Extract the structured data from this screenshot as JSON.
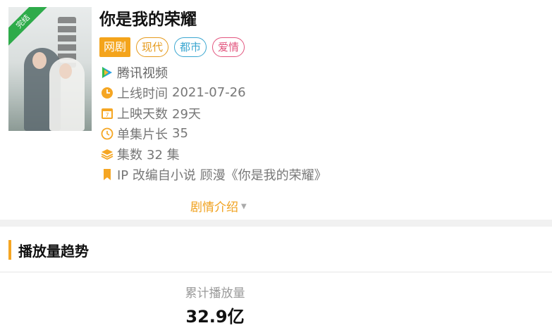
{
  "drama": {
    "poster_badge": "完结",
    "title": "你是我的荣耀",
    "type_tag": "网剧",
    "genre_tags": [
      "现代",
      "都市",
      "爱情"
    ],
    "platform": "腾讯视频",
    "release_label": "上线时间",
    "release_date": "2021-07-26",
    "days_label": "上映天数",
    "days_value": "29天",
    "episode_len_label": "单集片长",
    "episode_len_value": "35",
    "episodes_label": "集数",
    "episodes_value": "32 集",
    "ip_text": "IP 改编自小说 顾漫《你是我的荣耀》",
    "intro_link": "剧情介绍"
  },
  "trend": {
    "section_title": "播放量趋势",
    "total_label": "累计播放量",
    "total_value": "32.9亿"
  },
  "colors": {
    "accent": "#f5a623",
    "tag_modern": "#e59a1c",
    "tag_city": "#3aa6d0",
    "tag_romance": "#e2557e",
    "badge_green": "#2eab4a"
  },
  "icons": {
    "platform": "tencent-video-icon",
    "release": "clock-icon",
    "days": "calendar-icon",
    "length": "timer-icon",
    "episodes": "layers-icon",
    "ip": "bookmark-icon"
  }
}
